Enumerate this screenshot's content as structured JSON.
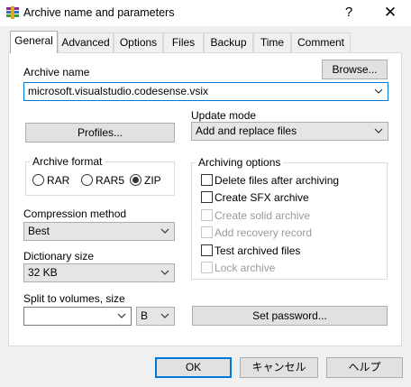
{
  "window": {
    "title": "Archive name and parameters",
    "help_glyph": "?",
    "close_glyph": "✕"
  },
  "tabs": [
    {
      "label": "General",
      "active": true
    },
    {
      "label": "Advanced",
      "active": false
    },
    {
      "label": "Options",
      "active": false
    },
    {
      "label": "Files",
      "active": false
    },
    {
      "label": "Backup",
      "active": false
    },
    {
      "label": "Time",
      "active": false
    },
    {
      "label": "Comment",
      "active": false
    }
  ],
  "archive": {
    "name_label": "Archive name",
    "browse_label": "Browse...",
    "name_value": "microsoft.visualstudio.codesense.vsix"
  },
  "profiles_label": "Profiles...",
  "update_mode": {
    "label": "Update mode",
    "value": "Add and replace files"
  },
  "archive_format": {
    "title": "Archive format",
    "options": [
      {
        "label": "RAR",
        "selected": false
      },
      {
        "label": "RAR5",
        "selected": false
      },
      {
        "label": "ZIP",
        "selected": true
      }
    ]
  },
  "compression": {
    "label": "Compression method",
    "value": "Best"
  },
  "dictionary": {
    "label": "Dictionary size",
    "value": "32 KB"
  },
  "split": {
    "label": "Split to volumes, size",
    "value": "",
    "unit": "B"
  },
  "archiving_options": {
    "title": "Archiving options",
    "items": [
      {
        "label": "Delete files after archiving",
        "checked": false,
        "enabled": true
      },
      {
        "label": "Create SFX archive",
        "checked": false,
        "enabled": true
      },
      {
        "label": "Create solid archive",
        "checked": false,
        "enabled": false
      },
      {
        "label": "Add recovery record",
        "checked": false,
        "enabled": false
      },
      {
        "label": "Test archived files",
        "checked": false,
        "enabled": true
      },
      {
        "label": "Lock archive",
        "checked": false,
        "enabled": false
      }
    ]
  },
  "set_password_label": "Set password...",
  "footer": {
    "ok": "OK",
    "cancel": "キャンセル",
    "help": "ヘルプ"
  },
  "colors": {
    "default_button_border": "#0078d7",
    "dialog_background": "#f0f0f0",
    "disabled_text": "#9b9b9b"
  }
}
